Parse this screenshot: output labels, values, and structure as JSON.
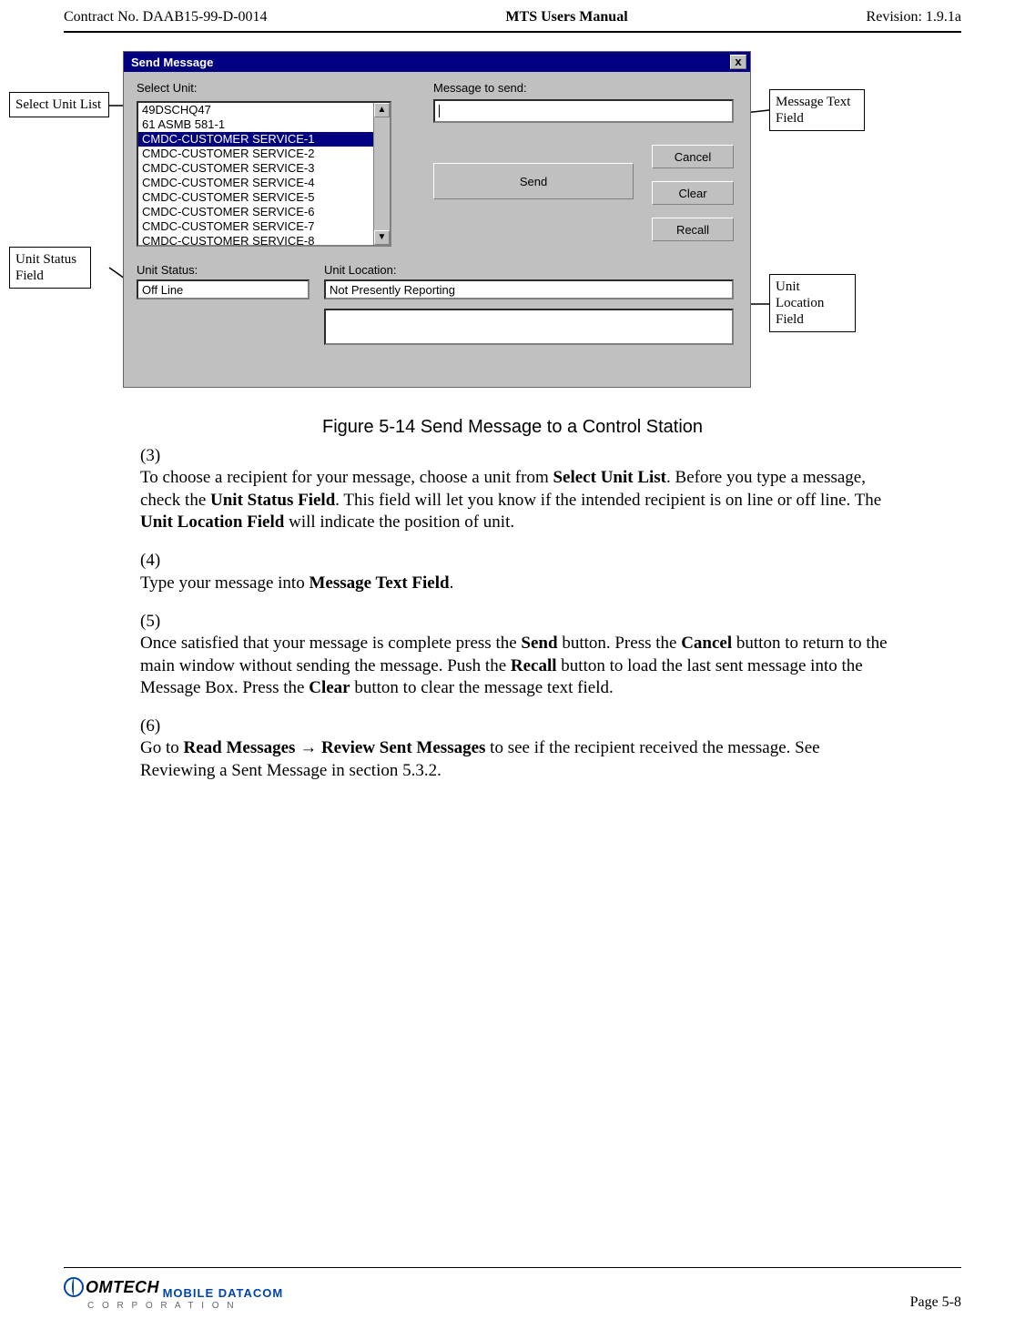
{
  "header": {
    "left": "Contract No. DAAB15-99-D-0014",
    "center": "MTS Users Manual",
    "right": "Revision:  1.9.1a"
  },
  "callouts": {
    "selectUnitList": "Select Unit List",
    "messageTextField": "Message Text Field",
    "unitStatusField": "Unit Status Field",
    "unitLocationField": "Unit Location Field"
  },
  "dialog": {
    "title": "Send Message",
    "close_label": "x",
    "labels": {
      "selectUnit": "Select Unit:",
      "messageToSend": "Message to send:",
      "unitStatus": "Unit Status:",
      "unitLocation": "Unit Location:"
    },
    "list": {
      "items": [
        "49DSCHQ47",
        "61 ASMB 581-1",
        "CMDC-CUSTOMER SERVICE-1",
        "CMDC-CUSTOMER SERVICE-2",
        "CMDC-CUSTOMER SERVICE-3",
        "CMDC-CUSTOMER SERVICE-4",
        "CMDC-CUSTOMER SERVICE-5",
        "CMDC-CUSTOMER SERVICE-6",
        "CMDC-CUSTOMER SERVICE-7",
        "CMDC-CUSTOMER SERVICE-8"
      ],
      "selected_index": 2,
      "scroll_up": "▲",
      "scroll_down": "▼"
    },
    "buttons": {
      "send": "Send",
      "cancel": "Cancel",
      "clear": "Clear",
      "recall": "Recall"
    },
    "fields": {
      "unitStatus_value": "Off Line",
      "unitLocation_value": "Not Presently Reporting",
      "message_value": ""
    }
  },
  "caption": "Figure 5-14   Send Message to a Control Station",
  "paragraphs": {
    "p3": {
      "num": "(3)",
      "t1": "To choose a recipient for your message, choose a unit from ",
      "b1": "Select Unit List",
      "t2": ". Before you type a message, check the ",
      "b2": "Unit Status Field",
      "t3": ".  This field will let you know if the intended recipient is on line or off line.  The ",
      "b3": "Unit Location Field",
      "t4": " will indicate the position of unit."
    },
    "p4": {
      "num": "(4)",
      "t1": "Type your message into ",
      "b1": "Message Text Field",
      "t2": "."
    },
    "p5": {
      "num": "(5)",
      "t1": "Once satisfied that your message is complete press the ",
      "b1": "Send",
      "t2": " button.  Press the ",
      "b2": "Cancel",
      "t3": " button to return to the main window without sending the message. Push the ",
      "b3": "Recall",
      "t4": " button to load the last sent message into the Message Box. Press the ",
      "b4": "Clear",
      "t5": " button to clear the message text field."
    },
    "p6": {
      "num": "(6)",
      "t1": "Go to ",
      "b1": "Read Messages",
      "arrow": " → ",
      "b2": "Review Sent Messages",
      "t2": " to see if the recipient received the message. See Reviewing a Sent Message in section 5.3.2."
    }
  },
  "footer": {
    "page": "Page 5-8",
    "logo": {
      "brand1": "OMTECH",
      "brand2": "MOBILE DATACOM",
      "brand3": "C O R P O R A T I O N"
    }
  }
}
